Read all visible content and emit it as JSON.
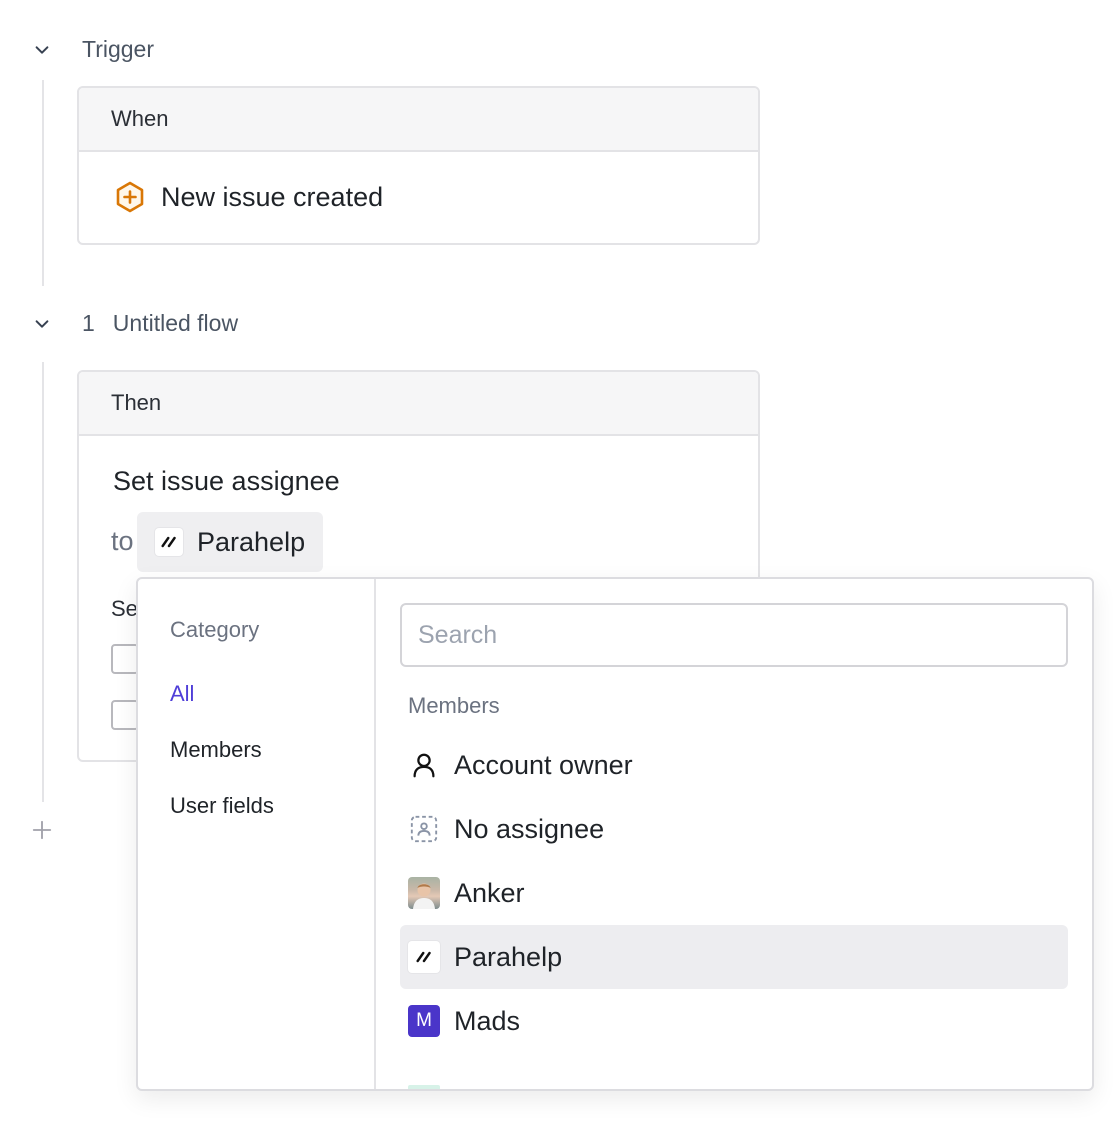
{
  "trigger": {
    "section_label": "Trigger",
    "card_header": "When",
    "event_label": "New issue created",
    "event_icon": "hexagon-plus-icon",
    "event_color": "#d97706"
  },
  "flow": {
    "number": "1",
    "title": "Untitled flow",
    "card_header": "Then",
    "action_title": "Set issue assignee",
    "to_label": "to",
    "assignee_value": "Parahelp",
    "truncated_label": "Se"
  },
  "dropdown": {
    "category_title": "Category",
    "categories": [
      {
        "label": "All",
        "active": true
      },
      {
        "label": "Members",
        "active": false
      },
      {
        "label": "User fields",
        "active": false
      }
    ],
    "search_placeholder": "Search",
    "search_value": "",
    "group_title": "Members",
    "options": [
      {
        "label": "Account owner",
        "icon": "person-outline-icon",
        "highlighted": false
      },
      {
        "label": "No assignee",
        "icon": "dashed-person-icon",
        "highlighted": false
      },
      {
        "label": "Anker",
        "icon": "avatar-photo",
        "highlighted": false
      },
      {
        "label": "Parahelp",
        "icon": "parahelp-logo-icon",
        "highlighted": true
      },
      {
        "label": "Mads",
        "icon": "avatar-initial",
        "initial": "M",
        "highlighted": false
      }
    ]
  },
  "colors": {
    "accent": "#4f3ed8",
    "avatar_m": "#4a35c9",
    "highlight_bg": "#ededf0"
  }
}
